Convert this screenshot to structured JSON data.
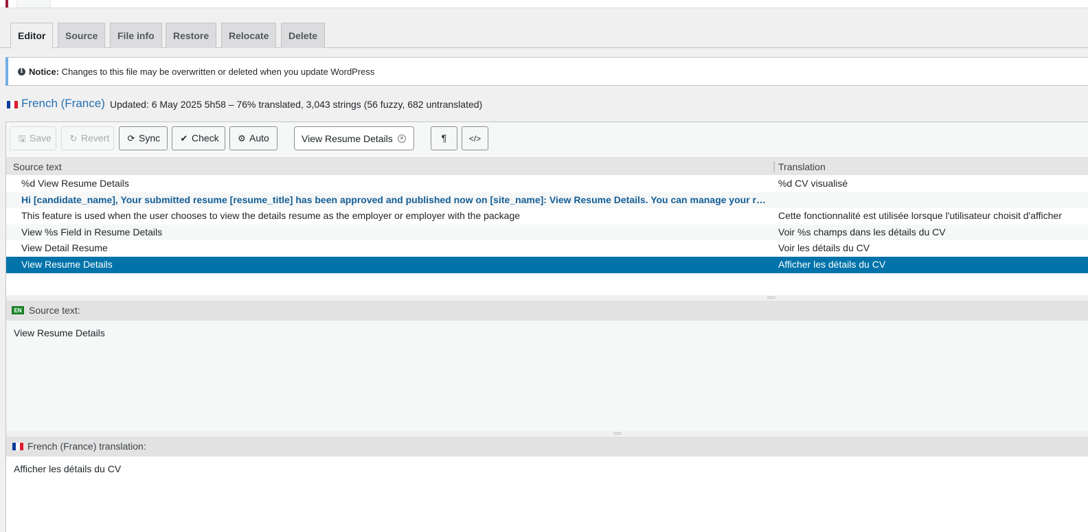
{
  "tabs": [
    {
      "label": "Editor",
      "active": true
    },
    {
      "label": "Source",
      "active": false
    },
    {
      "label": "File info",
      "active": false
    },
    {
      "label": "Restore",
      "active": false
    },
    {
      "label": "Relocate",
      "active": false
    },
    {
      "label": "Delete",
      "active": false
    }
  ],
  "notice": {
    "bold": "Notice:",
    "text": " Changes to this file may be overwritten or deleted when you update WordPress"
  },
  "language": {
    "name": "French (France)",
    "meta": "Updated: 6 May 2025 5h58 – 76% translated, 3,043 strings (56 fuzzy, 682 untranslated)"
  },
  "toolbar": {
    "save": "Save",
    "revert": "Revert",
    "sync": "Sync",
    "check": "Check",
    "auto": "Auto",
    "filter_value": "View Resume Details"
  },
  "table": {
    "headers": {
      "source": "Source text",
      "translation": "Translation"
    },
    "rows": [
      {
        "source": "%d View Resume Details",
        "translation": "%d CV visualisé"
      },
      {
        "source": "Hi [candidate_name], Your submitted resume [resume_title] has been approved and published now on [site_name]: View Resume Details. You can manage your resumes from your dashboard.",
        "translation": ""
      },
      {
        "source": "This feature is used when the user chooses to view the details resume as the employer or employer with the package",
        "translation": "Cette fonctionnalité est utilisée lorsque l'utilisateur choisit d'afficher"
      },
      {
        "source": "View %s Field in Resume Details",
        "translation": "Voir %s champs dans les détails du CV"
      },
      {
        "source": "View Detail Resume",
        "translation": "Voir les détails du CV"
      },
      {
        "source": "View Resume Details",
        "translation": "Afficher les détails du CV"
      }
    ]
  },
  "source_pane": {
    "badge": "EN",
    "label": "Source text:",
    "text": "View Resume Details"
  },
  "translation_pane": {
    "label": "French (France) translation:",
    "text": "Afficher les détails du CV"
  },
  "colors": {
    "accent": "#2271b1",
    "selected_row": "#0073aa",
    "untranslated_text": "#135e96"
  }
}
